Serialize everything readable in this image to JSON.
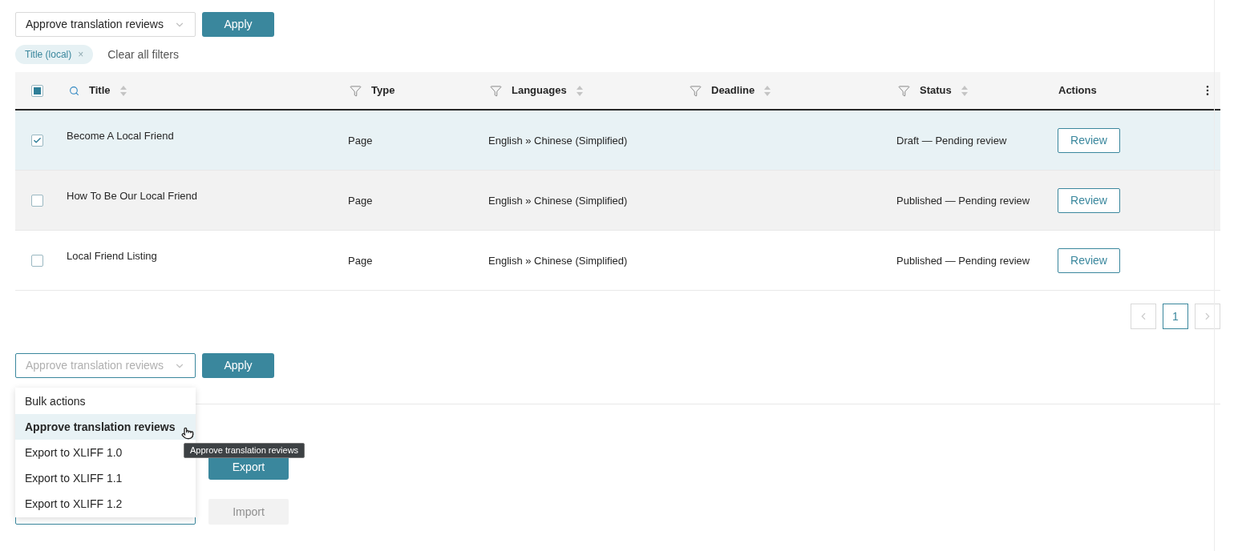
{
  "top_bulk": {
    "select": {
      "value": "Approve translation reviews",
      "open": false
    },
    "apply": "Apply"
  },
  "filters": {
    "chips": [
      {
        "label": "Title (local)",
        "remove": "×"
      }
    ],
    "clear": "Clear all filters"
  },
  "table": {
    "select_all": {
      "indeterminate": true
    },
    "columns": [
      {
        "label": "Title",
        "kind": "search",
        "sortable": true
      },
      {
        "label": "Type",
        "kind": "filter",
        "sortable": false
      },
      {
        "label": "Languages",
        "kind": "filter",
        "sortable": true
      },
      {
        "label": "Deadline",
        "kind": "filter",
        "sortable": true
      },
      {
        "label": "Status",
        "kind": "filter",
        "sortable": true
      },
      {
        "label": "Actions",
        "kind": "plain",
        "sortable": false
      }
    ],
    "rows": [
      {
        "title": "Become A Local Friend",
        "type": "Page",
        "languages": "English » Chinese (Simplified)",
        "status": "Draft — Pending review",
        "action": "Review",
        "checked": true,
        "hovered": false
      },
      {
        "title": "How To Be Our Local Friend",
        "type": "Page",
        "languages": "English » Chinese (Simplified)",
        "status": "Published — Pending review",
        "action": "Review",
        "checked": false,
        "hovered": true
      },
      {
        "title": "Local Friend Listing",
        "type": "Page",
        "languages": "English » Chinese (Simplified)",
        "status": "Published — Pending review",
        "action": "Review",
        "checked": false,
        "hovered": false
      }
    ]
  },
  "pagination": {
    "pages": [
      {
        "label": "1",
        "selected": true
      }
    ]
  },
  "bottom_bulk": {
    "select": {
      "value": "Approve translation reviews",
      "open": true
    },
    "apply": "Apply",
    "menu": [
      {
        "label": "Bulk actions",
        "selected": false
      },
      {
        "label": "Approve translation reviews",
        "selected": true
      },
      {
        "label": "Export to XLIFF 1.0",
        "selected": false
      },
      {
        "label": "Export to XLIFF 1.1",
        "selected": false
      },
      {
        "label": "Export to XLIFF 1.2",
        "selected": false
      }
    ],
    "tooltip": "Approve translation reviews"
  },
  "export": {
    "button": "Export"
  },
  "import": {
    "button": "Import",
    "disabled": true
  }
}
